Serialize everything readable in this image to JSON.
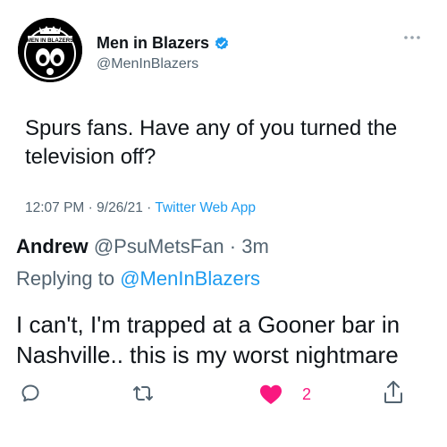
{
  "tweet": {
    "author": {
      "display_name": "Men in Blazers",
      "handle": "@MenInBlazers",
      "verified": true,
      "logo_text": "MEN IN BLAZERS"
    },
    "text": "Spurs fans. Have any of you turned the television off?",
    "time": "12:07 PM",
    "date": "9/26/21",
    "source": "Twitter Web App"
  },
  "reply": {
    "author_name": "Andrew",
    "author_handle": "@PsuMetsFan",
    "age": "3m",
    "replying_to_label": "Replying to",
    "replying_to_handle": "@MenInBlazers",
    "text": "I can't, I'm trapped at a Gooner bar in Nashville.. this is my worst nightmare",
    "like_count": "2"
  },
  "icons": {
    "reply": "reply-icon",
    "retweet": "retweet-icon",
    "like": "heart-icon",
    "share": "share-icon",
    "more": "more-icon",
    "verified": "verified-badge-icon"
  },
  "colors": {
    "text": "#0f1419",
    "secondary": "#536471",
    "link": "#1d9bf0",
    "like": "#f91880",
    "verified": "#1d9bf0"
  }
}
